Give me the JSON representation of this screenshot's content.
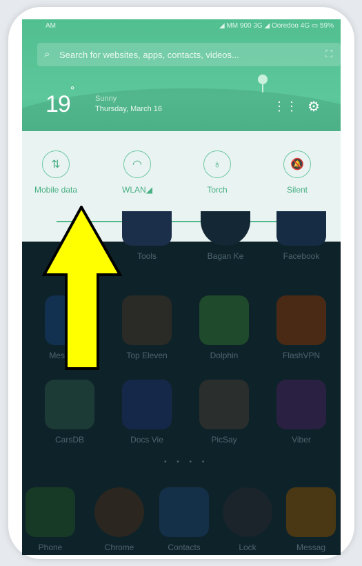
{
  "status": {
    "time": "AM",
    "right": "◢ MM 900 3G ◢ Ooredoo 4G ▭ 59%"
  },
  "search": {
    "placeholder": "Search for websites, apps, contacts, videos..."
  },
  "weather": {
    "temp": "19",
    "degree": "°",
    "condition": "Sunny",
    "date": "Thursday, March 16"
  },
  "toggles": [
    {
      "label": "Mobile data",
      "glyph": "⇅"
    },
    {
      "label": "WLAN◢",
      "glyph": "◠"
    },
    {
      "label": "Torch",
      "glyph": "♁"
    },
    {
      "label": "Silent",
      "glyph": "🔕"
    }
  ],
  "row1": [
    {
      "label": "Tools"
    },
    {
      "label": "Bagan Ke"
    },
    {
      "label": "Facebook"
    }
  ],
  "row2": [
    {
      "label": "Messenger"
    },
    {
      "label": "Top Eleven"
    },
    {
      "label": "Dolphin"
    },
    {
      "label": "FlashVPN"
    }
  ],
  "row3": [
    {
      "label": "CarsDB"
    },
    {
      "label": "Docs Vie"
    },
    {
      "label": "PicSay"
    },
    {
      "label": "Viber"
    }
  ],
  "dock": [
    {
      "label": "Phone"
    },
    {
      "label": "Chrome"
    },
    {
      "label": "Contacts"
    },
    {
      "label": "Lock"
    },
    {
      "label": "Messag"
    }
  ],
  "colors": {
    "accent": "#4fb98c",
    "arrow": "#ffff00"
  },
  "icons": {
    "search": "search-icon",
    "scan": "scan-icon",
    "apps": "grid-icon",
    "settings": "gear-icon",
    "brightness": "sun-icon"
  }
}
